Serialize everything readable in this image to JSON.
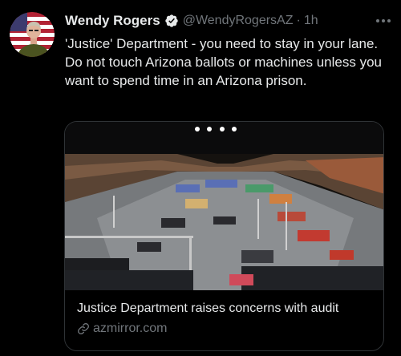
{
  "tweet": {
    "display_name": "Wendy Rogers",
    "handle": "@WendyRogersAZ",
    "separator": "·",
    "timestamp": "1h",
    "verified_icon": "verified-badge-icon",
    "more_icon": "more-options-icon",
    "text": "'Justice' Department - you need to stay in your lane. Do not touch Arizona ballots or machines unless you want to spend time in an Arizona prison."
  },
  "card": {
    "title": "Justice Department raises concerns with audit",
    "domain": "azmirror.com",
    "domain_icon": "link-icon"
  },
  "colors": {
    "background": "#000000",
    "primary_text": "#e7e9ea",
    "secondary_text": "#71767b",
    "border": "#2f3336",
    "verified": "#1d9bf0"
  }
}
